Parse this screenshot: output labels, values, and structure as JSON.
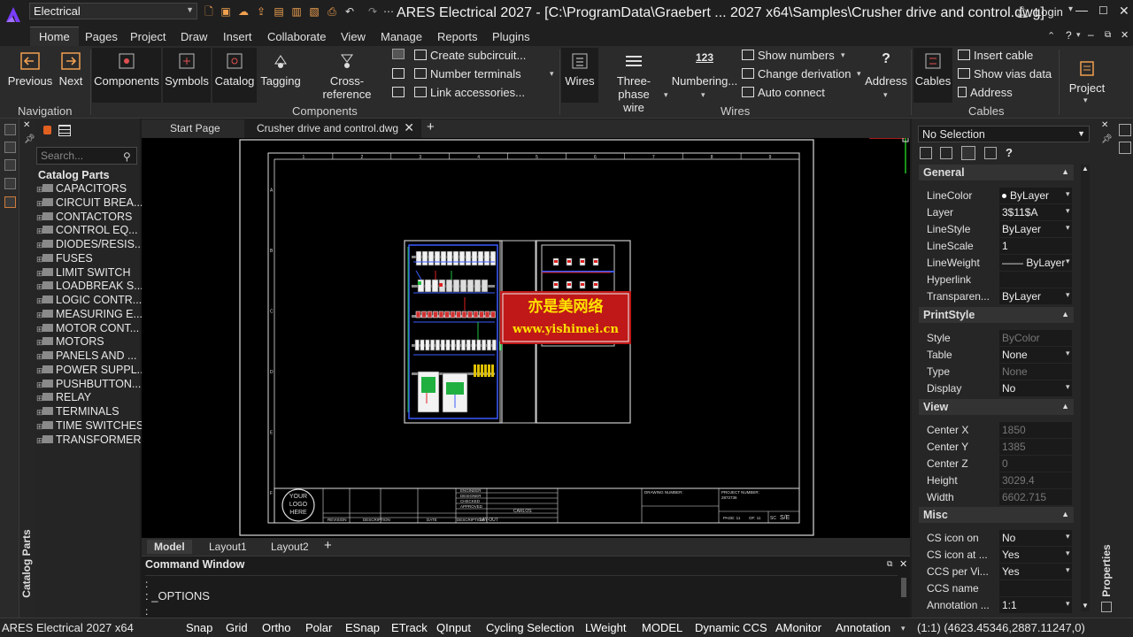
{
  "title_bar": {
    "workspace": "Electrical",
    "window_title": "ARES Electrical 2027 - [C:\\ProgramData\\Graebert ... 2027 x64\\Samples\\Crusher drive and control.dwg]",
    "login": "Login"
  },
  "menu_tabs": [
    "Home",
    "Pages",
    "Project",
    "Draw",
    "Insert",
    "Collaborate",
    "View",
    "Manage",
    "Reports",
    "Plugins"
  ],
  "ribbon": {
    "navigation": {
      "previous": "Previous",
      "next": "Next",
      "label": "Navigation"
    },
    "components": {
      "components": "Components",
      "symbols": "Symbols",
      "catalog": "Catalog",
      "tagging": "Tagging",
      "cross_reference": "Cross-reference",
      "create_subcircuit": "Create subcircuit...",
      "number_terminals": "Number terminals",
      "link_accessories": "Link accessories...",
      "label": "Components"
    },
    "wires": {
      "wires": "Wires",
      "three_phase": "Three-phase",
      "three_phase_2": "wire",
      "numbering": "Numbering...",
      "numbering_icon": "123",
      "show_numbers": "Show numbers",
      "change_derivation": "Change derivation",
      "auto_connect": "Auto connect",
      "address": "Address",
      "label": "Wires"
    },
    "cables": {
      "cables": "Cables",
      "insert_cable": "Insert cable",
      "show_vias": "Show vias data",
      "address": "Address",
      "label": "Cables"
    },
    "project": {
      "project": "Project"
    }
  },
  "catalog": {
    "search_placeholder": "Search...",
    "strip_label": "Catalog Parts",
    "root": "Catalog Parts",
    "items": [
      "CAPACITORS",
      "CIRCUIT BREA...",
      "CONTACTORS",
      "CONTROL EQ...",
      "DIODES/RESIS...",
      "FUSES",
      "LIMIT SWITCH",
      "LOADBREAK S...",
      "LOGIC CONTR...",
      "MEASURING E...",
      "MOTOR CONT...",
      "MOTORS",
      "PANELS AND ...",
      "POWER SUPPL...",
      "PUSHBUTTON...",
      "RELAY",
      "TERMINALS",
      "TIME SWITCHES",
      "TRANSFORMER"
    ]
  },
  "doc_tabs": {
    "start": "Start Page",
    "active": "Crusher drive and control.dwg"
  },
  "drawing": {
    "watermark_cn": "亦是美网络",
    "watermark_url": "www.yishimei.cn",
    "logo_text": [
      "YOUR",
      "LOGO",
      "HERE"
    ],
    "col_numbers": [
      "1",
      "2",
      "3",
      "4",
      "5",
      "6",
      "7",
      "8",
      "9"
    ],
    "row_letters": [
      "A",
      "B",
      "C",
      "D",
      "E",
      "F"
    ],
    "tb_roles": [
      "ENGINEER",
      "DESIGNER",
      "CHECKED",
      "APPROVED"
    ],
    "tb_approved_name": "CARLOS",
    "tb_headers": [
      "REVISION",
      "DESCRIPTION",
      "DATE",
      "DESCRIPTION"
    ],
    "tb_desc": "LAY-OUT",
    "drawing_number_label": "DRAWING NUMBER:",
    "project_number_label": "PROJECT NUMBER:",
    "project_number": "2872736",
    "page": "PAGE: 11",
    "of": "OF: 11",
    "sc_label": "SC",
    "sc_value": "S/E"
  },
  "layout_tabs": [
    "Model",
    "Layout1",
    "Layout2"
  ],
  "command": {
    "title": "Command Window",
    "line1": ":",
    "line2": ": _OPTIONS",
    "line3": ":"
  },
  "properties": {
    "selection": "No Selection",
    "strip_label": "Properties",
    "sections": {
      "general": {
        "title": "General",
        "rows": [
          [
            "LineColor",
            "ByLayer"
          ],
          [
            "Layer",
            "3$11$A"
          ],
          [
            "LineStyle",
            "ByLayer"
          ],
          [
            "LineScale",
            "1"
          ],
          [
            "LineWeight",
            "—— ByLayer"
          ],
          [
            "Hyperlink",
            ""
          ],
          [
            "Transparen...",
            "ByLayer"
          ]
        ]
      },
      "plotstyle": {
        "title": "PrintStyle",
        "rows": [
          [
            "Style",
            "ByColor"
          ],
          [
            "Table",
            "None"
          ],
          [
            "Type",
            "None"
          ],
          [
            "Display",
            "No"
          ]
        ]
      },
      "view": {
        "title": "View",
        "rows": [
          [
            "Center X",
            "1850"
          ],
          [
            "Center Y",
            "1385"
          ],
          [
            "Center Z",
            "0"
          ],
          [
            "Height",
            "3029.4"
          ],
          [
            "Width",
            "6602.715"
          ]
        ]
      },
      "misc": {
        "title": "Misc",
        "rows": [
          [
            "CS icon on",
            "No"
          ],
          [
            "CS icon at ...",
            "Yes"
          ],
          [
            "CCS per Vi...",
            "Yes"
          ],
          [
            "CCS name",
            ""
          ],
          [
            "Annotation ...",
            "1:1"
          ]
        ]
      }
    }
  },
  "status": {
    "app": "ARES Electrical 2027 x64",
    "toggles": [
      "Snap",
      "Grid",
      "Ortho",
      "Polar",
      "ESnap",
      "ETrack",
      "QInput",
      "Cycling Selection",
      "LWeight",
      "MODEL",
      "Dynamic CCS",
      "AMonitor",
      "Annotation"
    ],
    "coords": "(1:1) (4623.45346,2887.11247,0)"
  },
  "colors": {
    "accent": "#7a3cff",
    "watermark_red": "#e02020",
    "watermark_yellow": "#ffe000"
  }
}
